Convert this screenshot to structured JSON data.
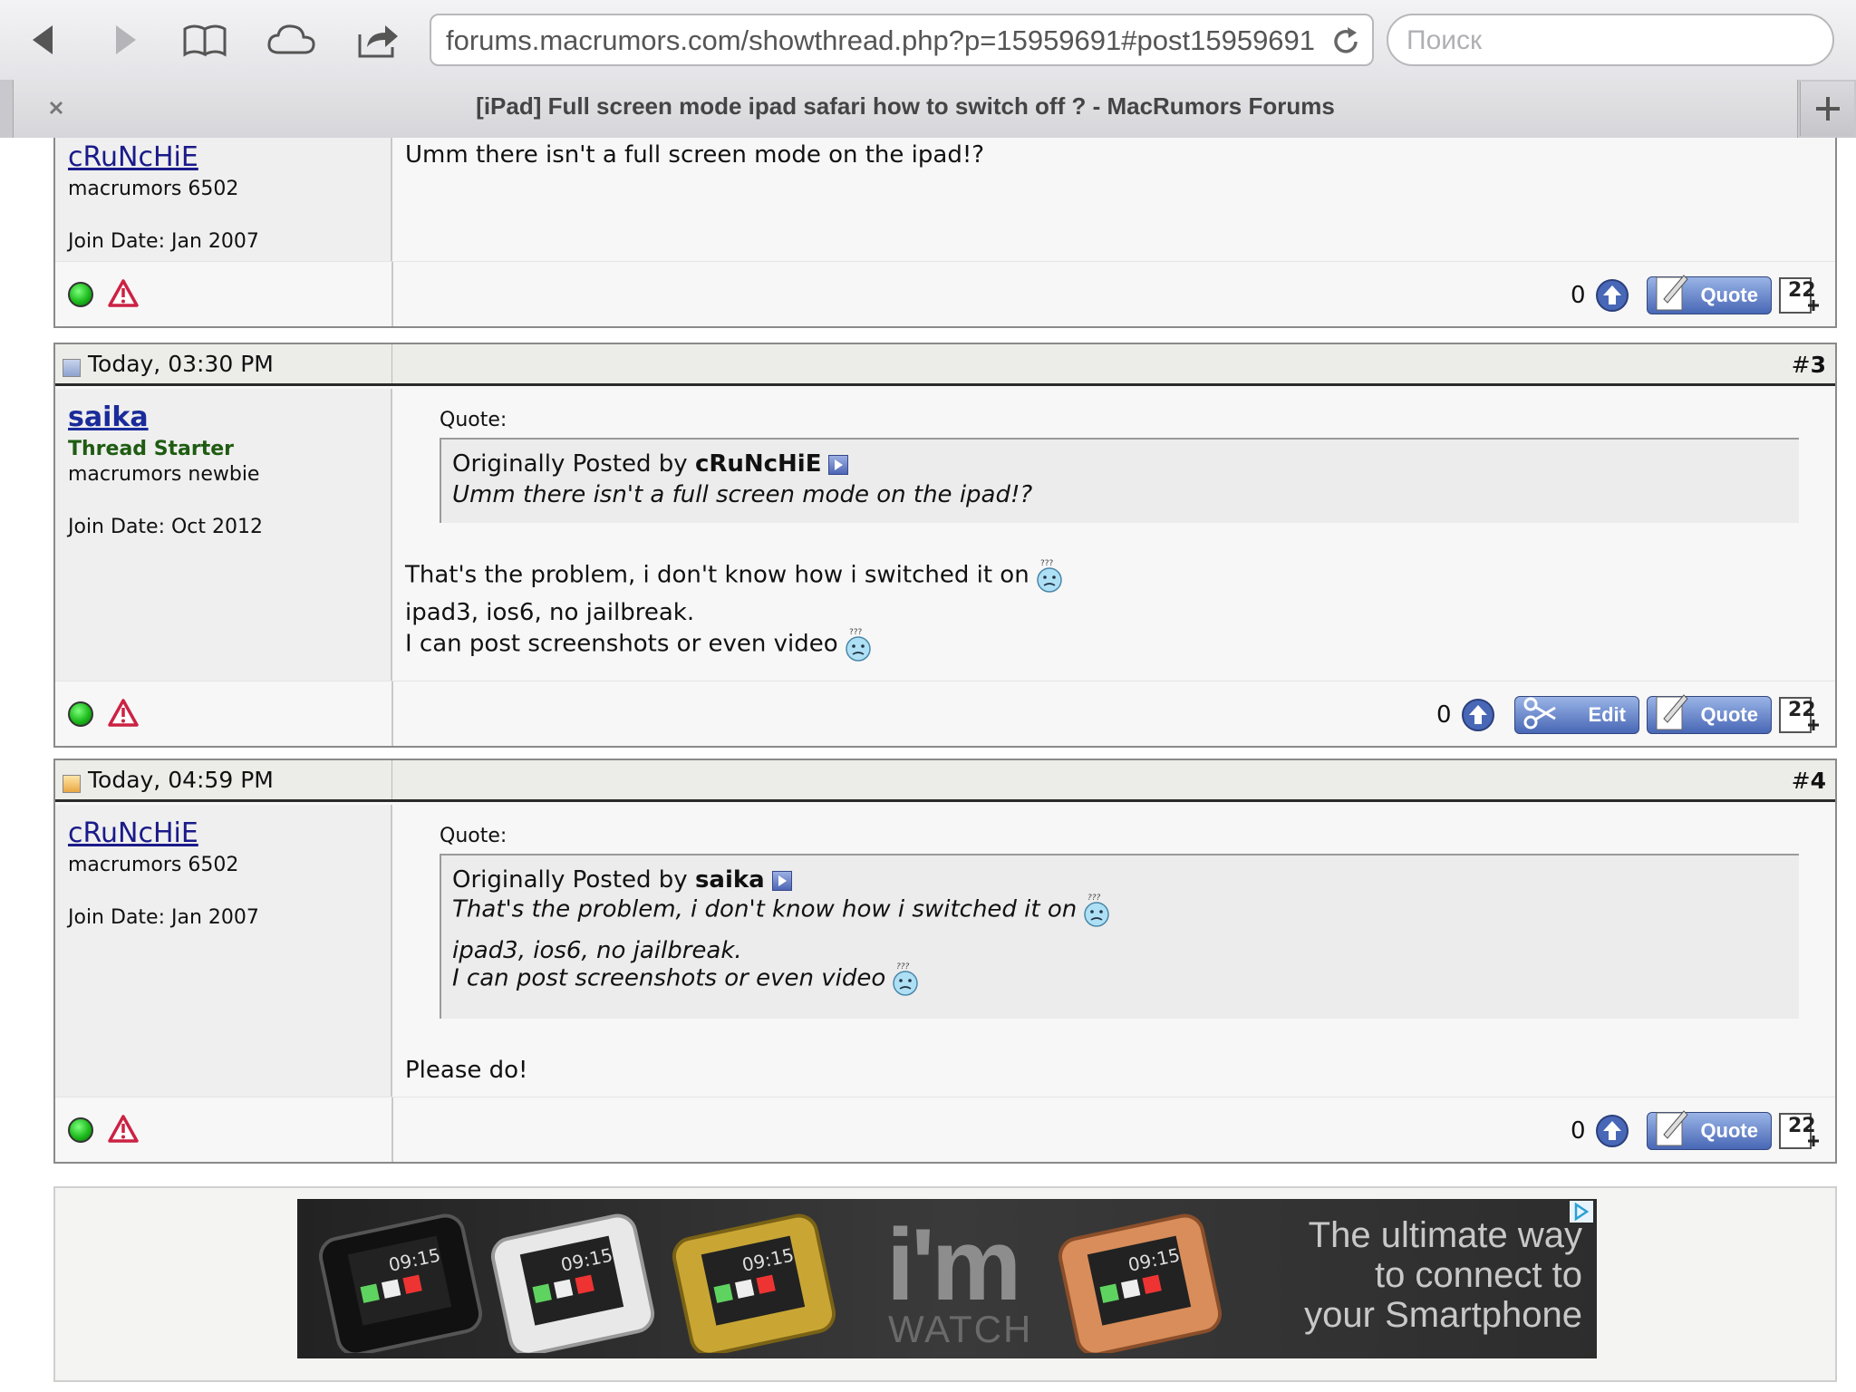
{
  "browser": {
    "url": "forums.macrumors.com/showthread.php?p=15959691#post15959691",
    "search_placeholder": "Поиск",
    "tab_title": "[iPad] Full screen mode ipad safari how to switch off ? - MacRumors Forums"
  },
  "posts": [
    {
      "username": "cRuNcHiE",
      "user_title": "macrumors 6502",
      "join_date": "Join Date: Jan 2007",
      "message": "Umm there isn't a full screen mode on the ipad!?",
      "votes": "0",
      "quote_button": "Quote"
    },
    {
      "date": "Today, 03:30 PM",
      "number_prefix": "#",
      "number": "3",
      "username": "saika",
      "starter_badge": "Thread Starter",
      "user_title": "macrumors newbie",
      "join_date": "Join Date: Oct 2012",
      "quote_label": "Quote:",
      "quote_prefix": "Originally Posted by",
      "quote_author": "cRuNcHiE",
      "quote_lines": [
        "Umm there isn't a full screen mode on the ipad!?"
      ],
      "message_lines": [
        "That's the problem, i don't know how i switched it on",
        "ipad3, ios6, no jailbreak.",
        "I can post screenshots or even video"
      ],
      "votes": "0",
      "edit_button": "Edit",
      "quote_button": "Quote"
    },
    {
      "date": "Today, 04:59 PM",
      "number_prefix": "#",
      "number": "4",
      "username": "cRuNcHiE",
      "user_title": "macrumors 6502",
      "join_date": "Join Date: Jan 2007",
      "quote_label": "Quote:",
      "quote_prefix": "Originally Posted by",
      "quote_author": "saika",
      "quote_lines": [
        "That's the problem, i don't know how i switched it on",
        "ipad3, ios6, no jailbreak.",
        "I can post screenshots or even video"
      ],
      "message_lines": [
        "Please do!"
      ],
      "votes": "0",
      "quote_button": "Quote"
    }
  ],
  "ad": {
    "brand": "i'm",
    "brand_sub": "WATCH",
    "slogan_lines": [
      "The ultimate way",
      "to connect to",
      "your Smartphone"
    ],
    "watch_time": "09:15"
  },
  "colors": {
    "link": "#1a1a8a",
    "starter": "#1f5c12",
    "button": "#4867b6"
  }
}
